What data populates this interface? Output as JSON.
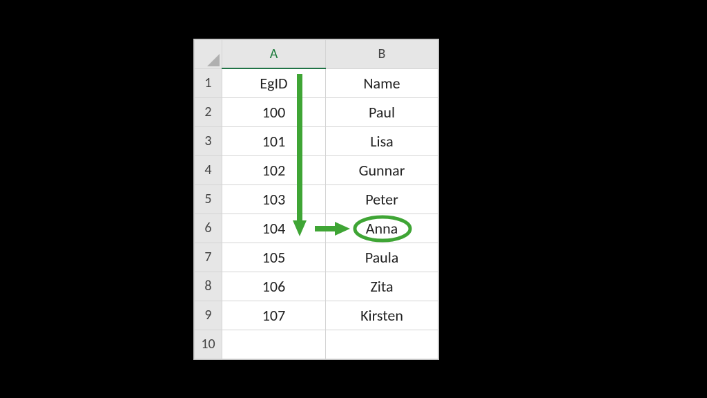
{
  "columns": [
    "A",
    "B"
  ],
  "rows": [
    "1",
    "2",
    "3",
    "4",
    "5",
    "6",
    "7",
    "8",
    "9",
    "10"
  ],
  "cells": {
    "A1": "EgID",
    "B1": "Name",
    "A2": "100",
    "B2": "Paul",
    "A3": "101",
    "B3": "Lisa",
    "A4": "102",
    "B4": "Gunnar",
    "A5": "103",
    "B5": "Peter",
    "A6": "104",
    "B6": "Anna",
    "A7": "105",
    "B7": "Paula",
    "A8": "106",
    "B8": "Zita",
    "A9": "107",
    "B9": "Kirsten",
    "A10": "",
    "B10": ""
  },
  "annotation": {
    "highlight_cell": "B6",
    "arrow_color": "#3fa535"
  }
}
